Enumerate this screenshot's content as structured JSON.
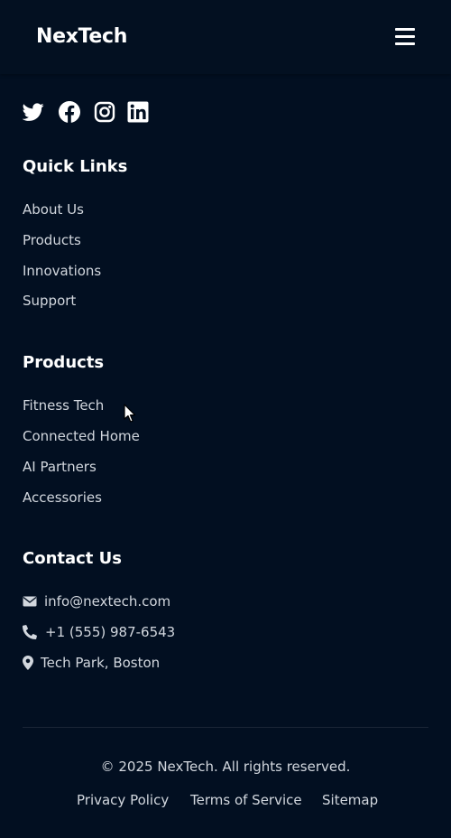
{
  "header": {
    "brand": "NexTech",
    "menu_icon": "hamburger-menu-icon"
  },
  "socials": [
    {
      "name": "Twitter",
      "icon": "twitter-icon"
    },
    {
      "name": "Facebook",
      "icon": "facebook-icon"
    },
    {
      "name": "Instagram",
      "icon": "instagram-icon"
    },
    {
      "name": "LinkedIn",
      "icon": "linkedin-icon"
    }
  ],
  "quick_links": {
    "title": "Quick Links",
    "items": [
      "About Us",
      "Products",
      "Innovations",
      "Support"
    ]
  },
  "products": {
    "title": "Products",
    "items": [
      "Fitness Tech",
      "Connected Home",
      "AI Partners",
      "Accessories"
    ]
  },
  "contact": {
    "title": "Contact Us",
    "email": {
      "icon": "envelope-icon",
      "text": "info@nextech.com"
    },
    "phone": {
      "icon": "phone-icon",
      "text": "+1 (555) 987-6543"
    },
    "location": {
      "icon": "map-pin-icon",
      "text": "Tech Park, Boston"
    }
  },
  "footer": {
    "copyright": "© 2025 NexTech. All rights reserved.",
    "links": [
      "Privacy Policy",
      "Terms of Service",
      "Sitemap"
    ]
  },
  "colors": {
    "background": "#020f21",
    "header": "#031021",
    "text": "#ffffff",
    "muted_text": "#d2d7de"
  }
}
